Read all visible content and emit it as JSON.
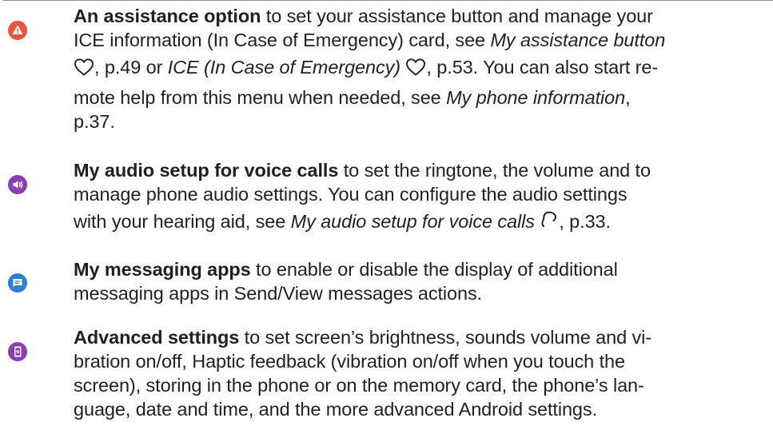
{
  "colors": {
    "warning": "#e8543e",
    "audio": "#8a3fb5",
    "messaging": "#2f7fd6",
    "advanced": "#8a3fb5",
    "text": "#231f20"
  },
  "items": [
    {
      "icon": "warning-triangle-icon",
      "lines": [
        {
          "segs": [
            {
              "t": "An assistance option",
              "s": "b"
            },
            {
              "t": " to set your assistance button and manage your",
              "s": ""
            }
          ]
        },
        {
          "segs": [
            {
              "t": "ICE information (In Case of Emergency) card, see ",
              "s": ""
            },
            {
              "t": "My assistance button",
              "s": "i"
            }
          ]
        },
        {
          "segs": [
            {
              "t": "",
              "s": "",
              "icon": "heart-outline-icon"
            },
            {
              "t": ", p.49 or ",
              "s": ""
            },
            {
              "t": "ICE (In Case of Emergency)",
              "s": "i"
            },
            {
              "t": " ",
              "s": "",
              "icon": "heart-outline-icon"
            },
            {
              "t": ", p.53. You can also start re-",
              "s": ""
            }
          ]
        },
        {
          "segs": [
            {
              "t": "mote help from this menu when needed, see ",
              "s": ""
            },
            {
              "t": "My phone information",
              "s": "i"
            },
            {
              "t": ",",
              "s": ""
            }
          ]
        },
        {
          "segs": [
            {
              "t": "p.37.",
              "s": ""
            }
          ]
        }
      ]
    },
    {
      "icon": "speaker-icon",
      "lines": [
        {
          "segs": [
            {
              "t": "My audio setup for voice calls",
              "s": "b"
            },
            {
              "t": " to set the ringtone, the volume and to",
              "s": ""
            }
          ]
        },
        {
          "segs": [
            {
              "t": "manage phone audio settings. You can configure the audio settings",
              "s": ""
            }
          ]
        },
        {
          "segs": [
            {
              "t": "with your hearing aid, see ",
              "s": ""
            },
            {
              "t": "My audio setup for voice calls",
              "s": "i"
            },
            {
              "t": " ",
              "s": "",
              "icon": "hearing-aid-icon"
            },
            {
              "t": ", p.33.",
              "s": ""
            }
          ]
        }
      ]
    },
    {
      "icon": "chat-bubble-icon",
      "lines": [
        {
          "segs": [
            {
              "t": "My messaging apps",
              "s": "b"
            },
            {
              "t": " to enable or disable the display of additional",
              "s": ""
            }
          ]
        },
        {
          "segs": [
            {
              "t": "messaging apps in Send/View messages actions.",
              "s": ""
            }
          ]
        }
      ]
    },
    {
      "icon": "settings-phone-icon",
      "lines": [
        {
          "segs": [
            {
              "t": "Advanced settings",
              "s": "b"
            },
            {
              "t": " to set screen’s brightness, sounds volume and vi-",
              "s": ""
            }
          ]
        },
        {
          "segs": [
            {
              "t": "bration on/off, Haptic feedback (vibration on/off when you touch the",
              "s": ""
            }
          ]
        },
        {
          "segs": [
            {
              "t": "screen), storing in the phone or on the memory card, the phone’s lan-",
              "s": ""
            }
          ]
        },
        {
          "segs": [
            {
              "t": "guage, date and time, and the more advanced Android settings.",
              "s": ""
            }
          ]
        }
      ]
    }
  ]
}
